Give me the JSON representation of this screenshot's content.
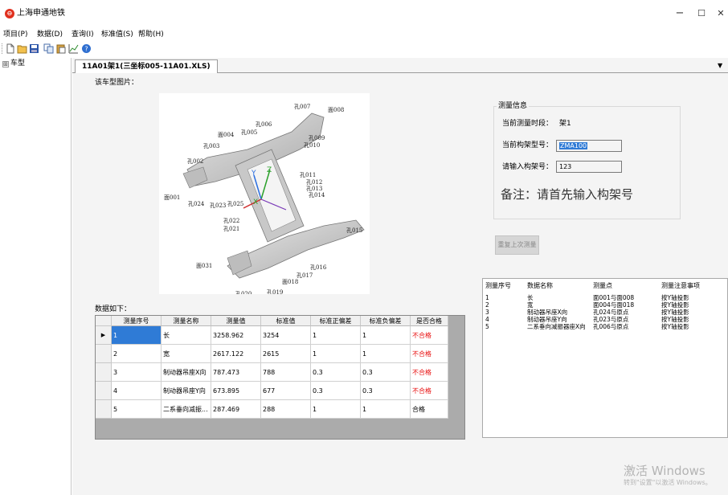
{
  "window": {
    "title": "上海申通地铁",
    "minimize": "−",
    "maximize": "☐",
    "close": "✕"
  },
  "menu": [
    "项目(P)",
    "数据(D)",
    "查询(I)",
    "标准值(S)",
    "帮助(H)"
  ],
  "toolbar_icons": [
    "new-file-icon",
    "open-folder-icon",
    "save-icon",
    "copy-icon",
    "paste-icon",
    "chart-icon",
    "help-icon"
  ],
  "tree": {
    "root_label": "车型",
    "expander": "⊞"
  },
  "tab": {
    "label": "11A01架1(三坐标005-11A01.XLS)",
    "dropdown": "▼"
  },
  "image_section": {
    "label": "该车型图片："
  },
  "diagram": {
    "labels": [
      "孔007",
      "面008",
      "孔006",
      "孔005",
      "面004",
      "孔009",
      "孔010",
      "孔003",
      "孔002",
      "孔011",
      "孔012",
      "孔013",
      "孔014",
      "面001",
      "孔024",
      "孔023",
      "孔025",
      "孔022",
      "孔021",
      "孔015",
      "面031",
      "孔016",
      "孔017",
      "面018",
      "孔019",
      "孔020"
    ],
    "axes": [
      "Y",
      "Z",
      "X"
    ]
  },
  "info": {
    "title": "测量信息",
    "time_label": "当前测量时段：",
    "time_value": "架1",
    "model_label": "当前构架型号：",
    "model_value": "ZMA100",
    "frame_label": "请输入构架号：",
    "frame_value": "123",
    "remark": "备注：请首先输入构架号"
  },
  "repeat_button": "重复上次测量",
  "right_list": {
    "headers": [
      "测量序号",
      "数据名称",
      "测量点",
      "测量注意事项"
    ],
    "rows": [
      [
        "1",
        "长",
        "面001与面008",
        "按Y轴投影"
      ],
      [
        "2",
        "宽",
        "面004与面018",
        "按Y轴投影"
      ],
      [
        "3",
        "制动器吊座X向",
        "孔024与原点",
        "按Y轴投影"
      ],
      [
        "4",
        "制动器吊座Y向",
        "孔023与原点",
        "按Y轴投影"
      ],
      [
        "5",
        "二系垂向减振器座X向",
        "孔006与原点",
        "按Y轴投影"
      ]
    ]
  },
  "grid": {
    "label": "数据如下：",
    "row_indicator": "▶",
    "headers": [
      "测量序号",
      "测量名称",
      "测量值",
      "标准值",
      "标准正偏差",
      "标准负偏差",
      "是否合格"
    ],
    "rows": [
      [
        "1",
        "长",
        "3258.962",
        "3254",
        "1",
        "1",
        "不合格"
      ],
      [
        "2",
        "宽",
        "2617.122",
        "2615",
        "1",
        "1",
        "不合格"
      ],
      [
        "3",
        "制动器吊座X向",
        "787.473",
        "788",
        "0.3",
        "0.3",
        "不合格"
      ],
      [
        "4",
        "制动器吊座Y向",
        "673.895",
        "677",
        "0.3",
        "0.3",
        "不合格"
      ],
      [
        "5",
        "二系垂向减振...",
        "287.469",
        "288",
        "1",
        "1",
        "合格"
      ]
    ]
  },
  "watermark": {
    "line1": "激活 Windows",
    "line2": "转到\"设置\"以激活 Windows。"
  },
  "colors": {
    "fail": "#e81010",
    "selected": "#2f7bd6",
    "logo": "#e0301e"
  }
}
